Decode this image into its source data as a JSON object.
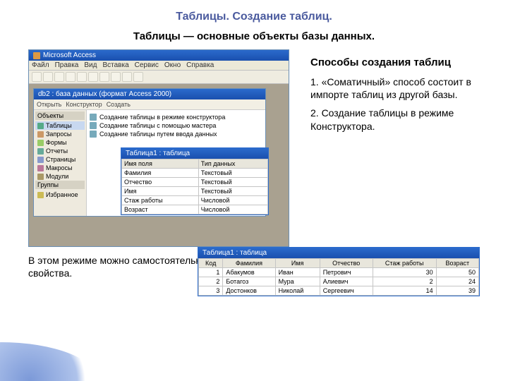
{
  "title": "Таблицы. Создание таблиц.",
  "subtitle": "Таблицы — основные объекты базы данных.",
  "section_title": "Способы создания таблиц",
  "point1": "1. «Соматичный» способ состоит в импорте таблиц из другой базы.",
  "point2": "2.  Создание таблицы в режиме Конструктора.",
  "bottom_text": "В этом режиме можно самостоятельно задать имена полей, выбрать их тип и  настроить свойства.",
  "app": {
    "title": "Microsoft Access",
    "menu": [
      "Файл",
      "Правка",
      "Вид",
      "Вставка",
      "Сервис",
      "Окно",
      "Справка"
    ]
  },
  "db_window": {
    "title": "db2 : база данных (формат Access 2000)",
    "toolbar": [
      "Открыть",
      "Конструктор",
      "Создать"
    ],
    "side_head": "Объекты",
    "side_items": [
      "Таблицы",
      "Запросы",
      "Формы",
      "Отчеты",
      "Страницы",
      "Макросы",
      "Модули"
    ],
    "groups_head": "Группы",
    "groups_item": "Избранное",
    "main_items": [
      "Создание таблицы в режиме конструктора",
      "Создание таблицы с помощью мастера",
      "Создание таблицы путем ввода данных"
    ]
  },
  "design": {
    "title": "Таблица1 : таблица",
    "head": [
      "Имя поля",
      "Тип данных"
    ],
    "rows": [
      [
        "Фамилия",
        "Текстовый"
      ],
      [
        "Отчество",
        "Текстовый"
      ],
      [
        "Имя",
        "Текстовый"
      ],
      [
        "Стаж работы",
        "Числовой"
      ],
      [
        "Возраст",
        "Числовой"
      ]
    ]
  },
  "datasheet": {
    "title": "Таблица1 : таблица",
    "head": [
      "Код",
      "Фамилия",
      "Имя",
      "Отчество",
      "Стаж работы",
      "Возраст"
    ],
    "rows": [
      [
        "1",
        "Абакумов",
        "Иван",
        "Петрович",
        "30",
        "50"
      ],
      [
        "2",
        "Ботагоз",
        "Мура",
        "Алиевич",
        "2",
        "24"
      ],
      [
        "3",
        "Достонков",
        "Николай",
        "Сергеевич",
        "14",
        "39"
      ]
    ]
  }
}
